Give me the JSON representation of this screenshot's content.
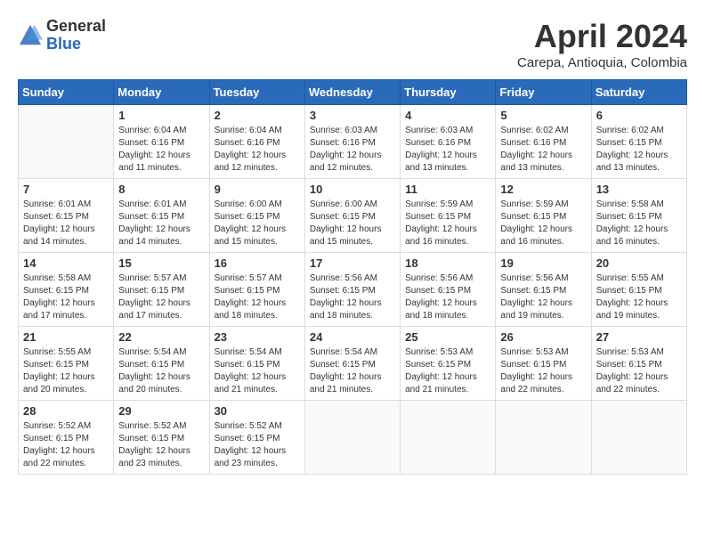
{
  "logo": {
    "general": "General",
    "blue": "Blue"
  },
  "header": {
    "month": "April 2024",
    "location": "Carepa, Antioquia, Colombia"
  },
  "weekdays": [
    "Sunday",
    "Monday",
    "Tuesday",
    "Wednesday",
    "Thursday",
    "Friday",
    "Saturday"
  ],
  "weeks": [
    [
      {
        "day": "",
        "sunrise": "",
        "sunset": "",
        "daylight": ""
      },
      {
        "day": "1",
        "sunrise": "Sunrise: 6:04 AM",
        "sunset": "Sunset: 6:16 PM",
        "daylight": "Daylight: 12 hours and 11 minutes."
      },
      {
        "day": "2",
        "sunrise": "Sunrise: 6:04 AM",
        "sunset": "Sunset: 6:16 PM",
        "daylight": "Daylight: 12 hours and 12 minutes."
      },
      {
        "day": "3",
        "sunrise": "Sunrise: 6:03 AM",
        "sunset": "Sunset: 6:16 PM",
        "daylight": "Daylight: 12 hours and 12 minutes."
      },
      {
        "day": "4",
        "sunrise": "Sunrise: 6:03 AM",
        "sunset": "Sunset: 6:16 PM",
        "daylight": "Daylight: 12 hours and 13 minutes."
      },
      {
        "day": "5",
        "sunrise": "Sunrise: 6:02 AM",
        "sunset": "Sunset: 6:16 PM",
        "daylight": "Daylight: 12 hours and 13 minutes."
      },
      {
        "day": "6",
        "sunrise": "Sunrise: 6:02 AM",
        "sunset": "Sunset: 6:15 PM",
        "daylight": "Daylight: 12 hours and 13 minutes."
      }
    ],
    [
      {
        "day": "7",
        "sunrise": "Sunrise: 6:01 AM",
        "sunset": "Sunset: 6:15 PM",
        "daylight": "Daylight: 12 hours and 14 minutes."
      },
      {
        "day": "8",
        "sunrise": "Sunrise: 6:01 AM",
        "sunset": "Sunset: 6:15 PM",
        "daylight": "Daylight: 12 hours and 14 minutes."
      },
      {
        "day": "9",
        "sunrise": "Sunrise: 6:00 AM",
        "sunset": "Sunset: 6:15 PM",
        "daylight": "Daylight: 12 hours and 15 minutes."
      },
      {
        "day": "10",
        "sunrise": "Sunrise: 6:00 AM",
        "sunset": "Sunset: 6:15 PM",
        "daylight": "Daylight: 12 hours and 15 minutes."
      },
      {
        "day": "11",
        "sunrise": "Sunrise: 5:59 AM",
        "sunset": "Sunset: 6:15 PM",
        "daylight": "Daylight: 12 hours and 16 minutes."
      },
      {
        "day": "12",
        "sunrise": "Sunrise: 5:59 AM",
        "sunset": "Sunset: 6:15 PM",
        "daylight": "Daylight: 12 hours and 16 minutes."
      },
      {
        "day": "13",
        "sunrise": "Sunrise: 5:58 AM",
        "sunset": "Sunset: 6:15 PM",
        "daylight": "Daylight: 12 hours and 16 minutes."
      }
    ],
    [
      {
        "day": "14",
        "sunrise": "Sunrise: 5:58 AM",
        "sunset": "Sunset: 6:15 PM",
        "daylight": "Daylight: 12 hours and 17 minutes."
      },
      {
        "day": "15",
        "sunrise": "Sunrise: 5:57 AM",
        "sunset": "Sunset: 6:15 PM",
        "daylight": "Daylight: 12 hours and 17 minutes."
      },
      {
        "day": "16",
        "sunrise": "Sunrise: 5:57 AM",
        "sunset": "Sunset: 6:15 PM",
        "daylight": "Daylight: 12 hours and 18 minutes."
      },
      {
        "day": "17",
        "sunrise": "Sunrise: 5:56 AM",
        "sunset": "Sunset: 6:15 PM",
        "daylight": "Daylight: 12 hours and 18 minutes."
      },
      {
        "day": "18",
        "sunrise": "Sunrise: 5:56 AM",
        "sunset": "Sunset: 6:15 PM",
        "daylight": "Daylight: 12 hours and 18 minutes."
      },
      {
        "day": "19",
        "sunrise": "Sunrise: 5:56 AM",
        "sunset": "Sunset: 6:15 PM",
        "daylight": "Daylight: 12 hours and 19 minutes."
      },
      {
        "day": "20",
        "sunrise": "Sunrise: 5:55 AM",
        "sunset": "Sunset: 6:15 PM",
        "daylight": "Daylight: 12 hours and 19 minutes."
      }
    ],
    [
      {
        "day": "21",
        "sunrise": "Sunrise: 5:55 AM",
        "sunset": "Sunset: 6:15 PM",
        "daylight": "Daylight: 12 hours and 20 minutes."
      },
      {
        "day": "22",
        "sunrise": "Sunrise: 5:54 AM",
        "sunset": "Sunset: 6:15 PM",
        "daylight": "Daylight: 12 hours and 20 minutes."
      },
      {
        "day": "23",
        "sunrise": "Sunrise: 5:54 AM",
        "sunset": "Sunset: 6:15 PM",
        "daylight": "Daylight: 12 hours and 21 minutes."
      },
      {
        "day": "24",
        "sunrise": "Sunrise: 5:54 AM",
        "sunset": "Sunset: 6:15 PM",
        "daylight": "Daylight: 12 hours and 21 minutes."
      },
      {
        "day": "25",
        "sunrise": "Sunrise: 5:53 AM",
        "sunset": "Sunset: 6:15 PM",
        "daylight": "Daylight: 12 hours and 21 minutes."
      },
      {
        "day": "26",
        "sunrise": "Sunrise: 5:53 AM",
        "sunset": "Sunset: 6:15 PM",
        "daylight": "Daylight: 12 hours and 22 minutes."
      },
      {
        "day": "27",
        "sunrise": "Sunrise: 5:53 AM",
        "sunset": "Sunset: 6:15 PM",
        "daylight": "Daylight: 12 hours and 22 minutes."
      }
    ],
    [
      {
        "day": "28",
        "sunrise": "Sunrise: 5:52 AM",
        "sunset": "Sunset: 6:15 PM",
        "daylight": "Daylight: 12 hours and 22 minutes."
      },
      {
        "day": "29",
        "sunrise": "Sunrise: 5:52 AM",
        "sunset": "Sunset: 6:15 PM",
        "daylight": "Daylight: 12 hours and 23 minutes."
      },
      {
        "day": "30",
        "sunrise": "Sunrise: 5:52 AM",
        "sunset": "Sunset: 6:15 PM",
        "daylight": "Daylight: 12 hours and 23 minutes."
      },
      {
        "day": "",
        "sunrise": "",
        "sunset": "",
        "daylight": ""
      },
      {
        "day": "",
        "sunrise": "",
        "sunset": "",
        "daylight": ""
      },
      {
        "day": "",
        "sunrise": "",
        "sunset": "",
        "daylight": ""
      },
      {
        "day": "",
        "sunrise": "",
        "sunset": "",
        "daylight": ""
      }
    ]
  ]
}
